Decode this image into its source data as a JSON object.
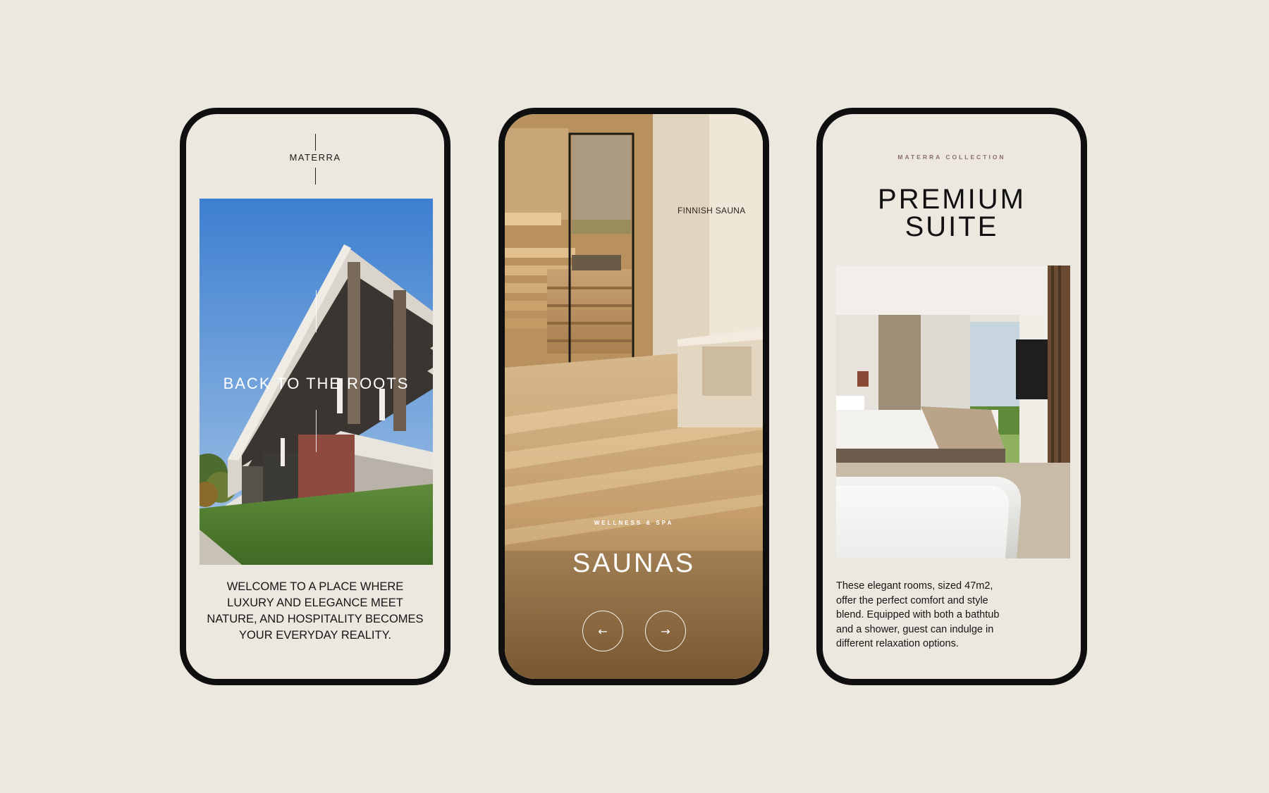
{
  "colors": {
    "background": "#ece8e0",
    "phone_frame": "#0f0f0f",
    "accent_eyebrow": "#8a6f66",
    "text": "#151515"
  },
  "screen1": {
    "logo": "MATERRA",
    "hero_title": "BACK TO THE ROOTS",
    "welcome_lines": [
      "WELCOME TO A PLACE WHERE",
      "LUXURY AND ELEGANCE MEET",
      "NATURE, AND HOSPITALITY BECOMES",
      "YOUR EVERYDAY REALITY."
    ]
  },
  "screen2": {
    "sign": "FINNISH SAUNA",
    "eyebrow": "WELLNESS & SPA",
    "title": "SAUNAS",
    "prev_icon": "arrow-left-icon",
    "next_icon": "arrow-right-icon",
    "prev_glyph": "←",
    "next_glyph": "→"
  },
  "screen3": {
    "eyebrow": "MATERRA COLLECTION",
    "title_line1": "PREMIUM",
    "title_line2": "SUITE",
    "description_lines": [
      "These elegant rooms, sized 47m2,",
      "offer the perfect comfort and style",
      "blend. Equipped with both a bathtub",
      "and a shower, guest can indulge in",
      "different relaxation options."
    ]
  }
}
